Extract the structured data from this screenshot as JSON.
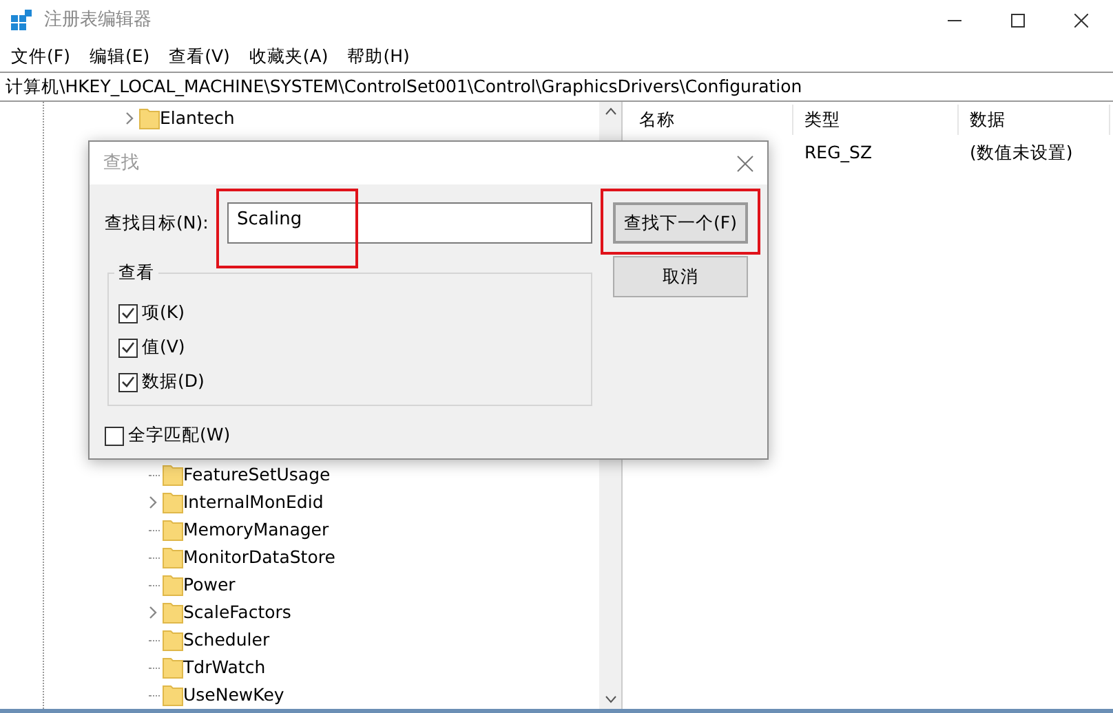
{
  "window": {
    "title": "注册表编辑器"
  },
  "menu": [
    "文件(F)",
    "编辑(E)",
    "查看(V)",
    "收藏夹(A)",
    "帮助(H)"
  ],
  "address": "计算机\\HKEY_LOCAL_MACHINE\\SYSTEM\\ControlSet001\\Control\\GraphicsDrivers\\Configuration",
  "tree": [
    {
      "label": "Elantech",
      "expandable": true
    },
    {
      "children": [
        {
          "label": "FeatureSetUsage",
          "expandable": false
        },
        {
          "label": "InternalMonEdid",
          "expandable": true
        },
        {
          "label": "MemoryManager",
          "expandable": false
        },
        {
          "label": "MonitorDataStore",
          "expandable": false
        },
        {
          "label": "Power",
          "expandable": false
        },
        {
          "label": "ScaleFactors",
          "expandable": true
        },
        {
          "label": "Scheduler",
          "expandable": false
        },
        {
          "label": "TdrWatch",
          "expandable": false
        },
        {
          "label": "UseNewKey",
          "expandable": false
        }
      ]
    }
  ],
  "values": {
    "columns": [
      "名称",
      "类型",
      "数据"
    ],
    "rows": [
      {
        "type": "REG_SZ",
        "data": "(数值未设置)"
      }
    ]
  },
  "dialog": {
    "title": "查找",
    "target_label": "查找目标(N):",
    "target": {
      "value": "Scaling",
      "highlighted": true
    },
    "buttons": [
      {
        "label": "查找下一个(F)",
        "default": true,
        "highlighted": true
      },
      {
        "label": "取消",
        "default": false,
        "highlighted": false
      }
    ],
    "group": {
      "title": "查看",
      "options": [
        {
          "label": "项(K)",
          "checked": true
        },
        {
          "label": "值(V)",
          "checked": true
        },
        {
          "label": "数据(D)",
          "checked": true
        }
      ]
    },
    "whole_word": {
      "label": "全字匹配(W)",
      "checked": false
    }
  }
}
